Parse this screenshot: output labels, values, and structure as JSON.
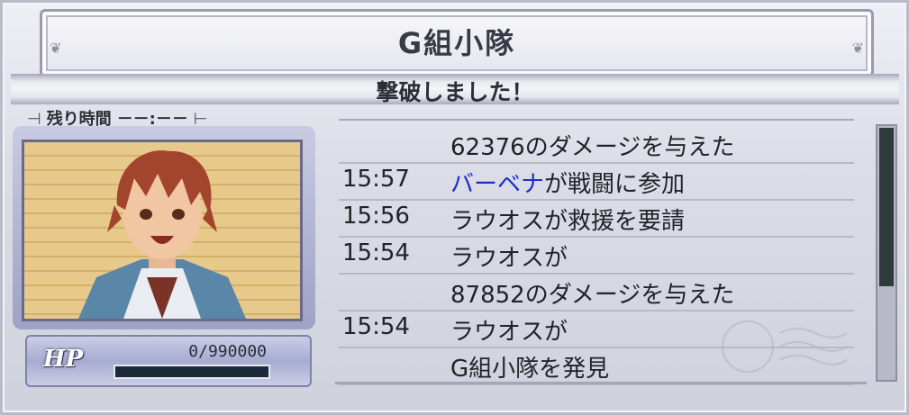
{
  "header": {
    "title": "G組小隊"
  },
  "status": {
    "message": "撃破しました！"
  },
  "timer": {
    "label": "残り時間",
    "value": "－－:－－"
  },
  "player": {
    "hp_label": "HP",
    "hp_value": "0/990000",
    "hp_fraction": 0
  },
  "log": {
    "rows": [
      {
        "time": "",
        "message": "62376のダメージを与えた"
      },
      {
        "time": "15:57",
        "message_name": "バーベナ",
        "message_rest": "が戦闘に参加"
      },
      {
        "time": "15:56",
        "message": "ラウオスが救援を要請"
      },
      {
        "time": "15:54",
        "message": "ラウオスが"
      },
      {
        "time": "",
        "message": "87852のダメージを与えた"
      },
      {
        "time": "15:54",
        "message": "ラウオスが"
      },
      {
        "time": "",
        "message": "G組小隊を発見"
      }
    ]
  },
  "colors": {
    "name_highlight": "#1a2fd0",
    "hp_bar_track": "#1a2a3a"
  }
}
